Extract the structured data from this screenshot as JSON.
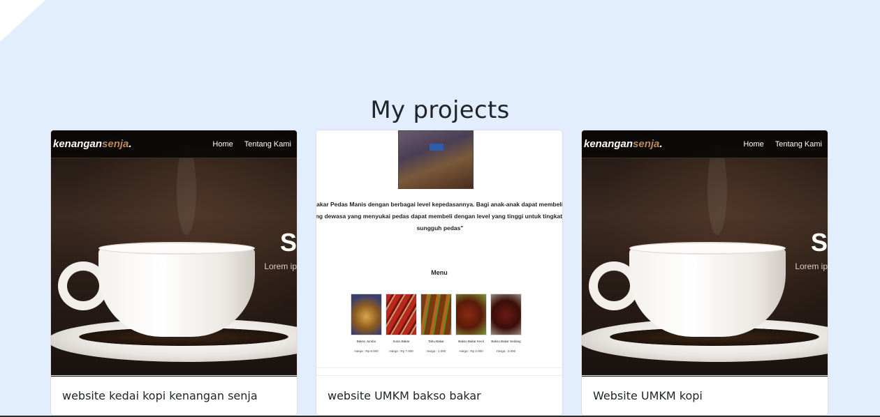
{
  "section": {
    "title": "My projects"
  },
  "projects": [
    {
      "caption": "website kedai kopi kenangan senja",
      "preview": {
        "logo_main": "kenangan",
        "logo_accent": "senja",
        "logo_dot": ".",
        "nav": [
          "Home",
          "Tentang Kami"
        ],
        "hero_heading": "S",
        "hero_text": "Lorem ip"
      }
    },
    {
      "caption": "website UMKM bakso bakar",
      "preview": {
        "quote_lines": [
          "Bakar Pedas Manis dengan berbagai level kepedasannya. Bagi anak-anak dapat membeli dengan",
          "ang dewasa yang menyukai pedas dapat membeli dengan level yang tinggi untuk tingkat rasa pedas",
          "sungguh pedas\""
        ],
        "menu_heading": "Menu",
        "menu_items": [
          {
            "name": "Bakso Jumbo",
            "price": "Harga : Rp 8.000"
          },
          {
            "name": "Sosis Bakar",
            "price": "Harga : Rp 7.000"
          },
          {
            "name": "Tahu Bakar",
            "price": "Harga : 1.000"
          },
          {
            "name": "Bakso Bakar Kecil",
            "price": "Harga : Rp 2.000"
          },
          {
            "name": "Bakso Bakar Sedang",
            "price": "Harga : 3.000"
          }
        ]
      }
    },
    {
      "caption": "Website UMKM kopi",
      "preview": {
        "logo_main": "kenangan",
        "logo_accent": "senja",
        "logo_dot": ".",
        "nav": [
          "Home",
          "Tentang Kami"
        ],
        "hero_heading": "S",
        "hero_text": "Lorem ip"
      }
    }
  ],
  "colors": {
    "page_background": "#e2edfe",
    "logo_accent": "#b6895b",
    "title_text": "#212529"
  }
}
